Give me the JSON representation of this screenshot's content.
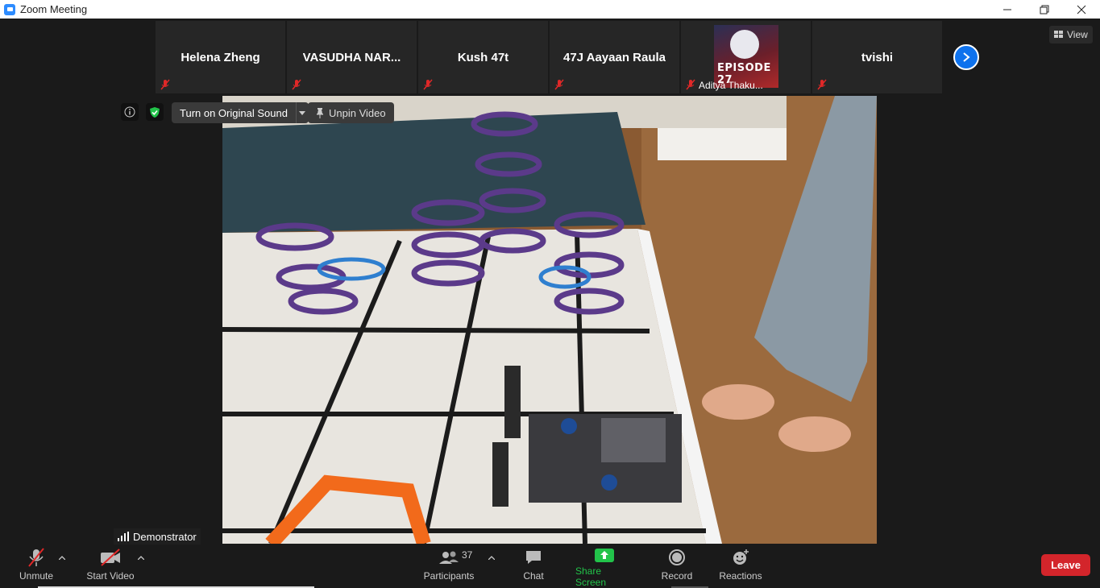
{
  "window": {
    "title": "Zoom Meeting",
    "minimize": "—",
    "restore": "❐",
    "close": "✕"
  },
  "participants_strip": [
    {
      "name": "Helena Zheng"
    },
    {
      "name": "VASUDHA NAR..."
    },
    {
      "name": "Kush 47t"
    },
    {
      "name": "47J Aayaan Raula"
    },
    {
      "name": "Aditya Thaku...",
      "avatar_text": "EPISODE 27"
    },
    {
      "name": "tvishi"
    }
  ],
  "view_label": "View",
  "overlay": {
    "original_sound": "Turn on Original Sound",
    "unpin": "Unpin Video",
    "speaker": "Demonstrator"
  },
  "toolbar": {
    "unmute": "Unmute",
    "start_video": "Start Video",
    "participants": "Participants",
    "participant_count": "37",
    "chat": "Chat",
    "share_screen": "Share Screen",
    "record": "Record",
    "reactions": "Reactions",
    "leave": "Leave"
  },
  "colors": {
    "accent_blue": "#0e72ed",
    "share_green": "#22c34a",
    "leave_red": "#d3252b",
    "muted_red": "#e02828"
  }
}
